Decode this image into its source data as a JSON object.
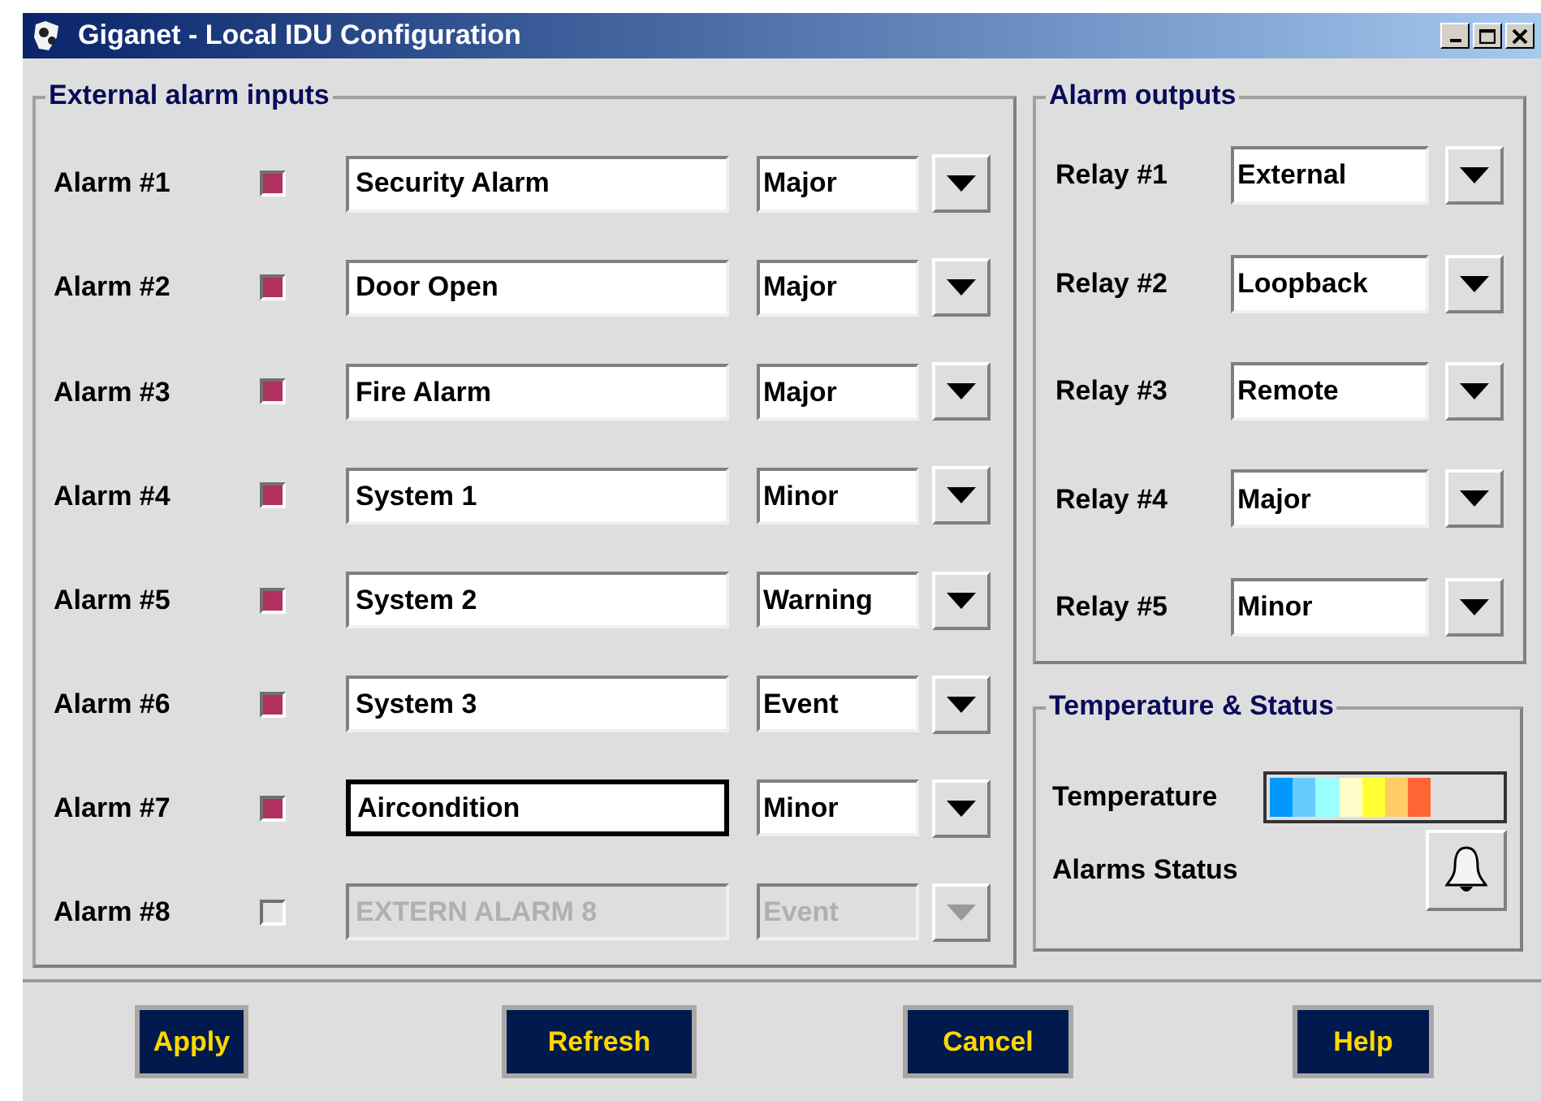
{
  "window": {
    "title": "Giganet - Local IDU Configuration"
  },
  "external_alarm_inputs": {
    "title": "External alarm inputs",
    "alarms": [
      {
        "label": "Alarm #1",
        "on": true,
        "name": "Security Alarm",
        "severity": "Major",
        "disabled": false,
        "focused": false
      },
      {
        "label": "Alarm #2",
        "on": true,
        "name": "Door Open",
        "severity": "Major",
        "disabled": false,
        "focused": false
      },
      {
        "label": "Alarm #3",
        "on": true,
        "name": "Fire Alarm",
        "severity": "Major",
        "disabled": false,
        "focused": false
      },
      {
        "label": "Alarm #4",
        "on": true,
        "name": "System 1",
        "severity": "Minor",
        "disabled": false,
        "focused": false
      },
      {
        "label": "Alarm #5",
        "on": true,
        "name": "System 2",
        "severity": "Warning",
        "disabled": false,
        "focused": false
      },
      {
        "label": "Alarm #6",
        "on": true,
        "name": "System 3",
        "severity": "Event",
        "disabled": false,
        "focused": false
      },
      {
        "label": "Alarm #7",
        "on": true,
        "name": "Aircondition",
        "severity": "Minor",
        "disabled": false,
        "focused": true
      },
      {
        "label": "Alarm #8",
        "on": false,
        "name": "EXTERN ALARM 8",
        "severity": "Event",
        "disabled": true,
        "focused": false
      }
    ]
  },
  "alarm_outputs": {
    "title": "Alarm outputs",
    "relays": [
      {
        "label": "Relay #1",
        "value": "External"
      },
      {
        "label": "Relay #2",
        "value": "Loopback"
      },
      {
        "label": "Relay #3",
        "value": "Remote"
      },
      {
        "label": "Relay #4",
        "value": "Major"
      },
      {
        "label": "Relay #5",
        "value": "Minor"
      }
    ]
  },
  "temperature_status": {
    "title": "Temperature & Status",
    "temperature_label": "Temperature",
    "temperature": {
      "level": 0.7
    },
    "alarms_status_label": "Alarms Status"
  },
  "buttons": [
    "Apply",
    "Refresh",
    "Cancel",
    "Help"
  ]
}
